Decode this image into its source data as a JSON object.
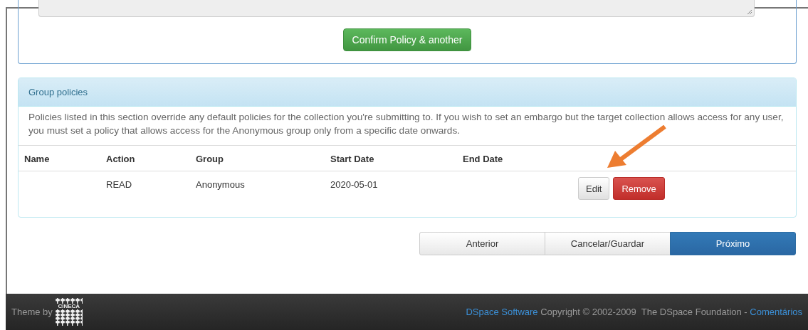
{
  "policy_form": {
    "confirm_button": "Confirm Policy & another"
  },
  "group_policies": {
    "title": "Group policies",
    "description": "Policies listed in this section override any default policies for the collection you're submitting to. If you wish to set an embargo but the target collection allows access for any user, you must set a policy that allows access for the Anonymous group only from a specific date onwards.",
    "columns": [
      "Name",
      "Action",
      "Group",
      "Start Date",
      "End Date"
    ],
    "rows": [
      {
        "cells": [
          "",
          "READ",
          "Anonymous",
          "2020-05-01",
          ""
        ],
        "edit": "Edit",
        "remove": "Remove"
      }
    ]
  },
  "navigation": [
    {
      "label": "Anterior",
      "kind": "default"
    },
    {
      "label": "Cancelar/Guardar",
      "kind": "default"
    },
    {
      "label": "Próximo",
      "kind": "primary"
    }
  ],
  "footer": {
    "theme_by": "Theme by",
    "logo_text": "CINECA",
    "software_link": "DSpace Software",
    "copyright": "Copyright © 2002-2009  The DSpace Foundation - ",
    "feedback_link": "Comentários"
  }
}
